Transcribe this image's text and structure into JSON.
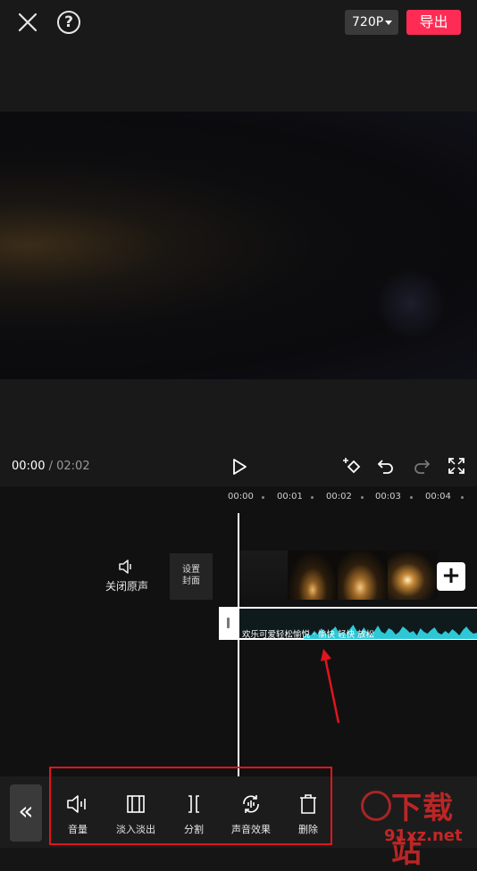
{
  "header": {
    "resolution": "720P",
    "export_label": "导出"
  },
  "player": {
    "current_time": "00:00",
    "separator": " / ",
    "total_time": "02:02"
  },
  "timeline": {
    "ticks": [
      "00:00",
      "00:01",
      "00:02",
      "00:03",
      "00:04"
    ],
    "mute_label": "关闭原声",
    "cover_label_1": "设置",
    "cover_label_2": "封面",
    "add_label": "+",
    "audio_title": "欢乐可爱轻松愉悦 · 愉快 轻快 放松"
  },
  "toolbar": {
    "collapse_label": "«",
    "items": [
      {
        "label": "音量",
        "icon": "volume-icon"
      },
      {
        "label": "淡入淡出",
        "icon": "fade-icon"
      },
      {
        "label": "分割",
        "icon": "split-icon"
      },
      {
        "label": "声音效果",
        "icon": "sound-effect-icon"
      },
      {
        "label": "删除",
        "icon": "delete-icon"
      }
    ]
  },
  "watermark": {
    "text_big": "下载站",
    "text_small": "91xz.net"
  },
  "colors": {
    "accent": "#fe2c55",
    "waveform": "#2ec7d6",
    "highlight": "#e1141e"
  }
}
